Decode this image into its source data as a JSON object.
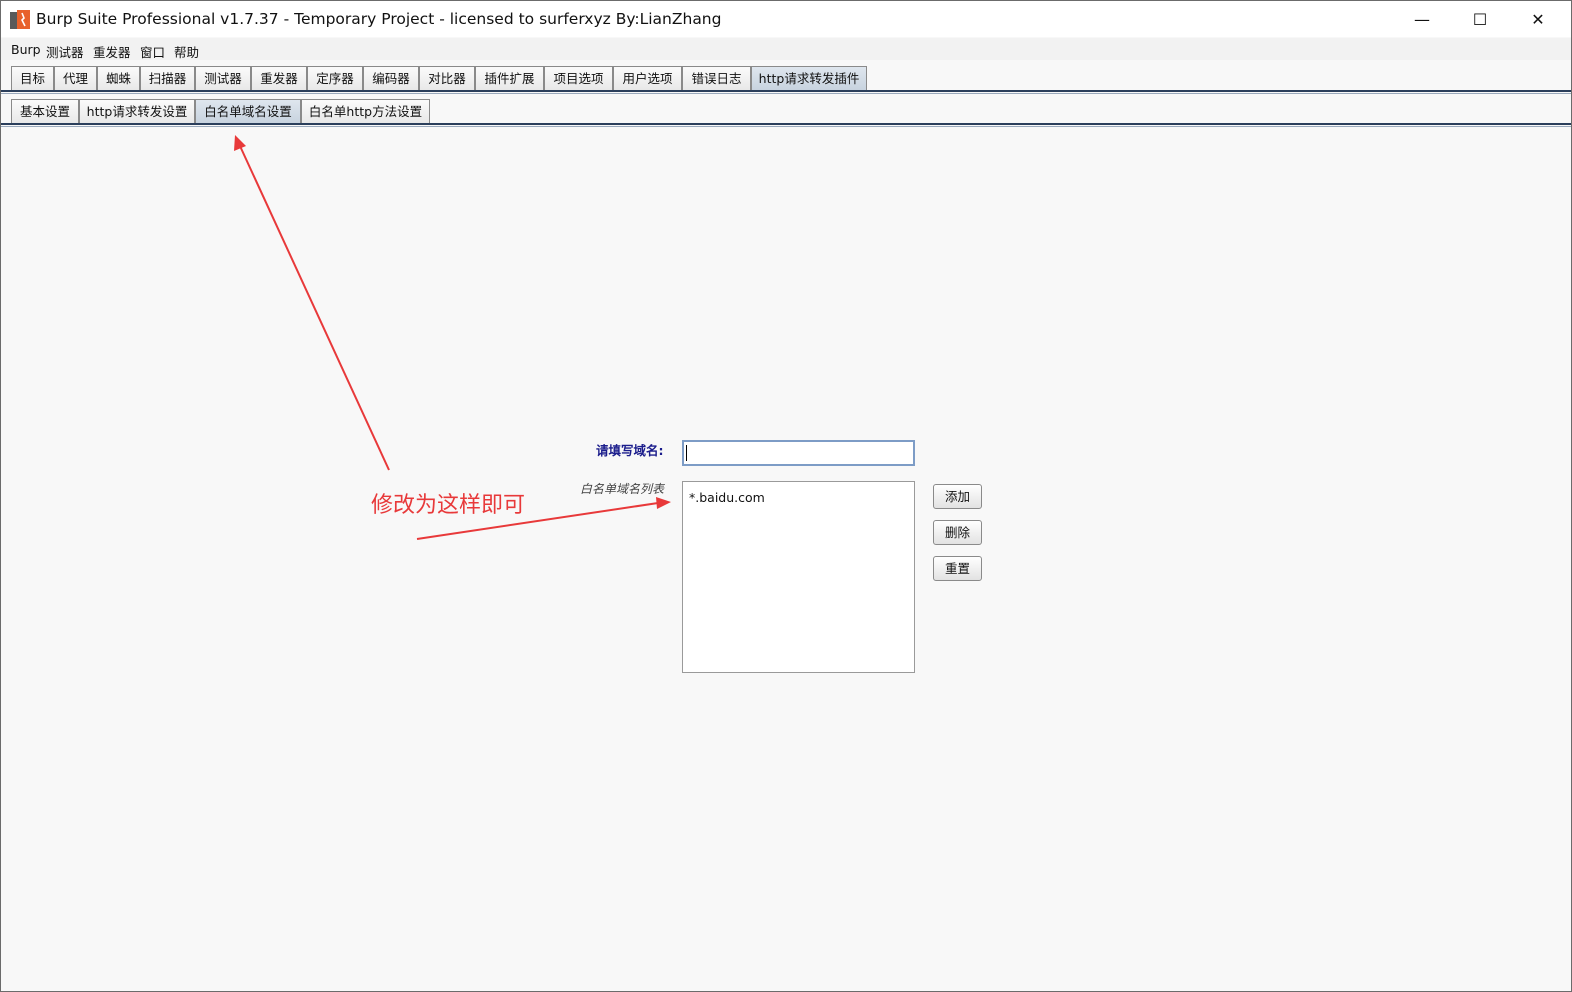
{
  "window": {
    "title": "Burp Suite Professional v1.7.37 - Temporary Project - licensed to surferxyz By:LianZhang",
    "icon": "burp-logo-icon",
    "minimize_glyph": "—",
    "maximize_glyph": "☐",
    "close_glyph": "✕"
  },
  "menu": [
    "Burp",
    "测试器",
    "重发器",
    "窗口",
    "帮助"
  ],
  "main_tabs": [
    "目标",
    "代理",
    "蜘蛛",
    "扫描器",
    "测试器",
    "重发器",
    "定序器",
    "编码器",
    "对比器",
    "插件扩展",
    "项目选项",
    "用户选项",
    "错误日志",
    "http请求转发插件"
  ],
  "main_tab_active": "http请求转发插件",
  "sub_tabs": [
    "基本设置",
    "http请求转发设置",
    "白名单域名设置",
    "白名单http方法设置"
  ],
  "sub_tab_active": "白名单域名设置",
  "form": {
    "domain_label": "请填写域名:",
    "domain_value": "",
    "list_label": "白名单域名列表",
    "list_items": [
      "*.baidu.com"
    ],
    "add_label": "添加",
    "delete_label": "删除",
    "reset_label": "重置"
  },
  "annotation": {
    "text": "修改为这样即可",
    "color": "#e8393a"
  },
  "colors": {
    "tab_accent": "#2b3f5c",
    "label_blue": "#1b1d8c"
  }
}
